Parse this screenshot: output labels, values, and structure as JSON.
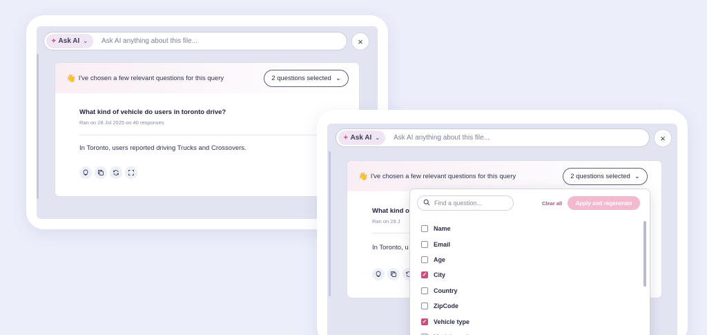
{
  "ask_pill_label": "Ask AI",
  "ask_placeholder": "Ask AI anything about this file...",
  "close_glyph": "×",
  "result": {
    "message": "I've chosen a few relevant questions for this query",
    "selected_label": "2 questions selected",
    "question": "What kind of vehicle do users in toronto drive?",
    "meta": "Ran on 28 Jul 2025 on 40 responses",
    "answer": "In Toronto, users reported driving Trucks and Crossovers.",
    "answer_partial": "In Toronto, u",
    "question_partial": "What kind of",
    "meta_partial": "Ran on 28 J"
  },
  "icons": {
    "sparkle": "sparkle-icon",
    "chevron": "chevron-down-icon",
    "close": "close-icon",
    "search": "search-icon",
    "actions": [
      "lightbulb-icon",
      "copy-icon",
      "refresh-icon",
      "expand-icon"
    ]
  },
  "dropdown": {
    "search_placeholder": "Find a question...",
    "clear_all": "Clear all",
    "apply": "Apply and regenerate",
    "options": [
      {
        "label": "Name",
        "checked": false
      },
      {
        "label": "Email",
        "checked": false
      },
      {
        "label": "Age",
        "checked": false
      },
      {
        "label": "City",
        "checked": true
      },
      {
        "label": "Country",
        "checked": false
      },
      {
        "label": "ZipCode",
        "checked": false
      },
      {
        "label": "Vehicle type",
        "checked": true
      },
      {
        "label": "Model number",
        "checked": false
      }
    ]
  },
  "colors": {
    "accent": "#c94f7f",
    "apply_disabled": "#f3b9cf",
    "background": "#eceefa"
  }
}
